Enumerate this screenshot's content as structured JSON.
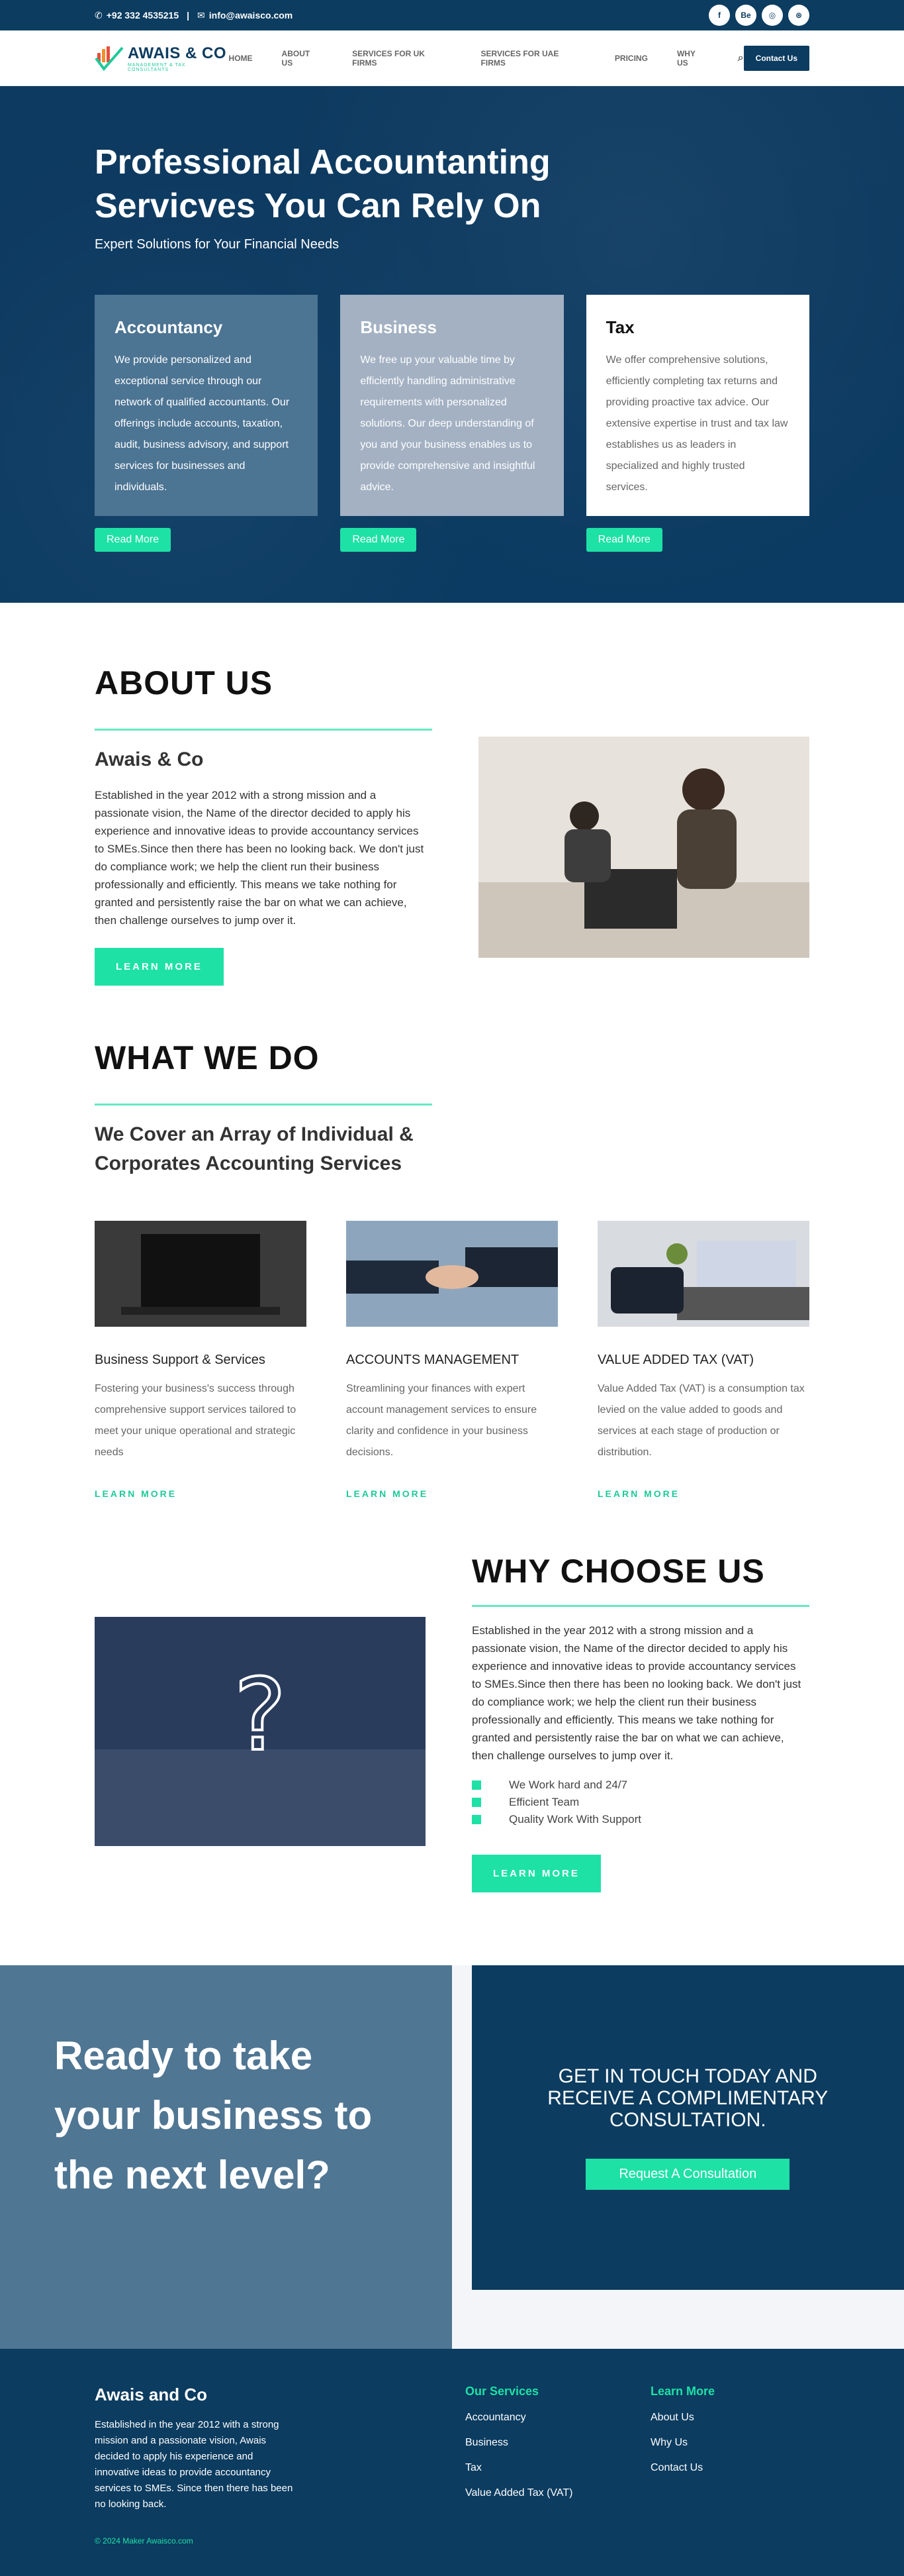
{
  "topbar": {
    "phone": "+92 332 4535215",
    "email": "info@awaisco.com",
    "socials": [
      {
        "icon": "facebook-icon",
        "glyph": "f"
      },
      {
        "icon": "behance-icon",
        "glyph": "Be"
      },
      {
        "icon": "instagram-icon",
        "glyph": "◎"
      },
      {
        "icon": "dribbble-icon",
        "glyph": "⊛"
      }
    ]
  },
  "header": {
    "logo_name": "AWAIS & CO",
    "logo_tag": "MANAGEMENT & TAX CONSULTANTS",
    "nav": [
      "HOME",
      "ABOUT US",
      "SERVICES FOR UK FIRMS",
      "SERVICES FOR UAE FIRMS",
      "PRICING",
      "WHY US"
    ],
    "contact_button": "Contact Us"
  },
  "hero": {
    "title": "Professional Accountanting Servicves You Can Rely On",
    "subtitle": "Expert Solutions for Your Financial Needs",
    "cards": [
      {
        "title": "Accountancy",
        "text": "We provide personalized and exceptional service through our network of qualified accountants. Our offerings include accounts, taxation, audit, business advisory, and support services for businesses and individuals.",
        "button": "Read More"
      },
      {
        "title": "Business",
        "text": "We free up your valuable time by efficiently handling administrative requirements with personalized solutions. Our deep understanding of you and your business enables us to provide comprehensive and insightful advice.",
        "button": "Read More"
      },
      {
        "title": "Tax",
        "text": "We offer comprehensive solutions, efficiently completing tax returns and providing proactive tax advice. Our extensive expertise in trust and tax law establishes us as leaders in specialized and highly trusted services.",
        "button": "Read More"
      }
    ]
  },
  "about": {
    "heading": "ABOUT US",
    "subheading": "Awais & Co",
    "body": "Established in the year 2012 with a strong mission and a passionate vision, the Name of the director decided to apply his experience and innovative ideas to provide accountancy services to SMEs.Since then there has been no looking back. We don't just do compliance work; we help the client run their business professionally and efficiently. This means we take nothing for granted and persistently raise the bar on what we can achieve, then challenge ourselves to jump over it.",
    "button": "LEARN MORE"
  },
  "whatwedo": {
    "heading": "WHAT WE DO",
    "subheading": "We Cover an Array of Individual & Corporates Accounting Services",
    "services": [
      {
        "title": "Business Support & Services",
        "text": "Fostering your business's success through comprehensive support services tailored to meet your unique operational and strategic needs",
        "link": "LEARN MORE"
      },
      {
        "title": "ACCOUNTS MANAGEMENT",
        "text": "Streamlining your finances with expert account management services to ensure clarity and confidence in your business decisions.",
        "link": "LEARN MORE"
      },
      {
        "title": "VALUE ADDED TAX (VAT)",
        "text": "Value Added Tax (VAT) is a consumption tax levied on the value added to goods and services at each stage of production or distribution.",
        "link": "LEARN MORE"
      }
    ]
  },
  "why": {
    "heading": "WHY CHOOSE US",
    "body": "Established in the year 2012 with a strong mission and a passionate vision, the Name of the director decided to apply his experience and innovative ideas to provide accountancy services to SMEs.Since then there has been no looking back. We don't just do compliance work; we help the client run their business professionally and efficiently. This means we take nothing for granted and persistently raise the bar on what we can achieve, then challenge ourselves to jump over it.",
    "features": [
      "We Work hard and 24/7",
      "Efficient Team",
      "Quality Work With Support"
    ],
    "button": "LEARN MORE"
  },
  "cta": {
    "headline": "Ready to take your business to the next level?",
    "box_text": "GET IN TOUCH TODAY AND RECEIVE A COMPLIMENTARY CONSULTATION.",
    "button": "Request A Consultation"
  },
  "footer": {
    "brand": "Awais and Co",
    "about": "Established in the year 2012 with a strong mission and a passionate vision, Awais decided to apply his experience and innovative ideas to provide accountancy services to SMEs. Since then there has been no looking back.",
    "copyright": "© 2024 Maker Awaisco.com",
    "services_title": "Our Services",
    "services": [
      "Accountancy",
      "Business",
      "Tax",
      "Value Added Tax (VAT)"
    ],
    "learn_title": "Learn More",
    "learn": [
      "About Us",
      "Why Us",
      "Contact Us"
    ]
  },
  "colors": {
    "navy": "#0c3c60",
    "accent_green": "#1ee1a6",
    "steel_blue": "#4f7693"
  }
}
